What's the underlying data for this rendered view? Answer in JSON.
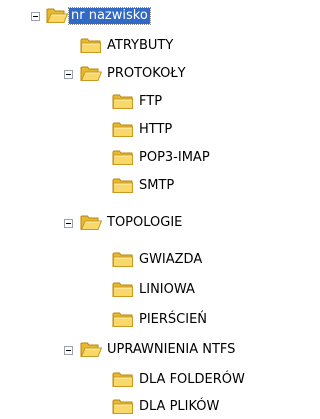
{
  "tree": {
    "root": {
      "label": "nr nazwisko",
      "expanded": true,
      "selected": true
    },
    "nodes": [
      {
        "label": "ATRYBUTY",
        "level": 1,
        "expanded": false,
        "has_children": false
      },
      {
        "label": "PROTOKOŁY",
        "level": 1,
        "expanded": true,
        "has_children": true
      },
      {
        "label": "FTP",
        "level": 2,
        "expanded": false,
        "has_children": false
      },
      {
        "label": "HTTP",
        "level": 2,
        "expanded": false,
        "has_children": false
      },
      {
        "label": "POP3-IMAP",
        "level": 2,
        "expanded": false,
        "has_children": false
      },
      {
        "label": "SMTP",
        "level": 2,
        "expanded": false,
        "has_children": false
      },
      {
        "label": "TOPOLOGIE",
        "level": 1,
        "expanded": true,
        "has_children": true
      },
      {
        "label": "GWIAZDA",
        "level": 2,
        "expanded": false,
        "has_children": false
      },
      {
        "label": "LINIOWA",
        "level": 2,
        "expanded": false,
        "has_children": false
      },
      {
        "label": "PIERŚCIEŃ",
        "level": 2,
        "expanded": false,
        "has_children": false
      },
      {
        "label": "UPRAWNIENIA NTFS",
        "level": 1,
        "expanded": true,
        "has_children": true
      },
      {
        "label": "DLA FOLDERÓW",
        "level": 2,
        "expanded": false,
        "has_children": false
      },
      {
        "label": "DLA PLIKÓW",
        "level": 2,
        "expanded": false,
        "has_children": false
      }
    ]
  },
  "colors": {
    "folder_fill": "#f6d365",
    "folder_edge": "#c99a1e",
    "selection": "#316ac5"
  }
}
